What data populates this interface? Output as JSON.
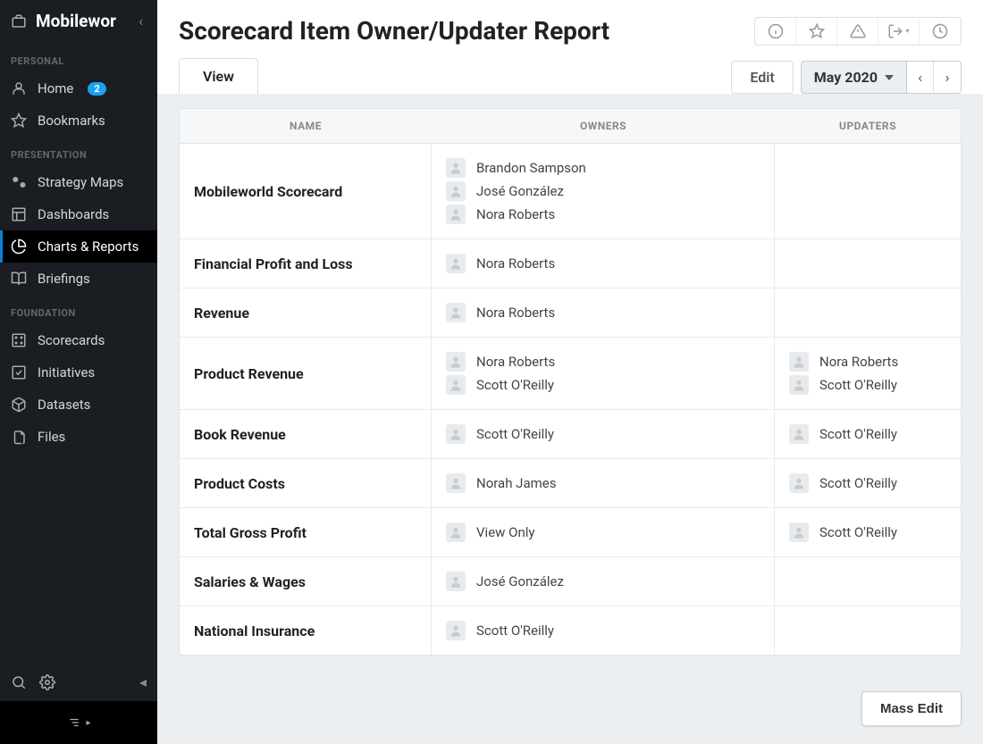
{
  "app": {
    "name": "Mobilewor"
  },
  "sidebar": {
    "sections": [
      {
        "label": "PERSONAL",
        "items": [
          {
            "label": "Home",
            "badge": "2",
            "icon": "user"
          },
          {
            "label": "Bookmarks",
            "icon": "star"
          }
        ]
      },
      {
        "label": "PRESENTATION",
        "items": [
          {
            "label": "Strategy Maps",
            "icon": "map"
          },
          {
            "label": "Dashboards",
            "icon": "dashboard"
          },
          {
            "label": "Charts & Reports",
            "icon": "pie",
            "active": true
          },
          {
            "label": "Briefings",
            "icon": "book"
          }
        ]
      },
      {
        "label": "FOUNDATION",
        "items": [
          {
            "label": "Scorecards",
            "icon": "grid"
          },
          {
            "label": "Initiatives",
            "icon": "check"
          },
          {
            "label": "Datasets",
            "icon": "cube"
          },
          {
            "label": "Files",
            "icon": "file"
          }
        ]
      }
    ]
  },
  "header": {
    "title": "Scorecard Item Owner/Updater Report",
    "tabs": {
      "view": "View",
      "edit": "Edit"
    },
    "period": "May 2020",
    "massEdit": "Mass Edit"
  },
  "table": {
    "columns": {
      "name": "NAME",
      "owners": "OWNERS",
      "updaters": "UPDATERS"
    },
    "rows": [
      {
        "name": "Mobileworld Scorecard",
        "owners": [
          "Brandon Sampson",
          "José González",
          "Nora Roberts"
        ],
        "updaters": []
      },
      {
        "name": "Financial Profit and Loss",
        "owners": [
          "Nora Roberts"
        ],
        "updaters": []
      },
      {
        "name": "Revenue",
        "owners": [
          "Nora Roberts"
        ],
        "updaters": []
      },
      {
        "name": "Product Revenue",
        "owners": [
          "Nora Roberts",
          "Scott O'Reilly"
        ],
        "updaters": [
          "Nora Roberts",
          "Scott O'Reilly"
        ]
      },
      {
        "name": "Book Revenue",
        "owners": [
          "Scott O'Reilly"
        ],
        "updaters": [
          "Scott O'Reilly"
        ]
      },
      {
        "name": "Product Costs",
        "owners": [
          "Norah James"
        ],
        "updaters": [
          "Scott O'Reilly"
        ]
      },
      {
        "name": "Total Gross Profit",
        "owners": [
          "View Only"
        ],
        "updaters": [
          "Scott O'Reilly"
        ]
      },
      {
        "name": "Salaries & Wages",
        "owners": [
          "José González"
        ],
        "updaters": []
      },
      {
        "name": "National Insurance",
        "owners": [
          "Scott O'Reilly"
        ],
        "updaters": []
      }
    ]
  }
}
